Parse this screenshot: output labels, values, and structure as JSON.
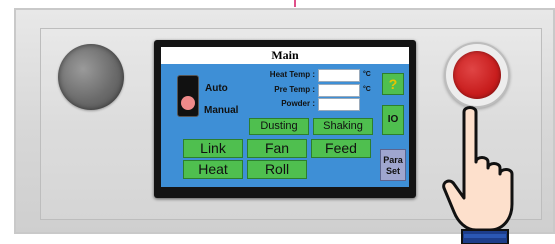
{
  "screen": {
    "title": "Main",
    "mode": {
      "auto_label": "Auto",
      "manual_label": "Manual"
    },
    "fields": [
      {
        "label": "Heat Temp :",
        "value": "",
        "unit": "°C"
      },
      {
        "label": "Pre Temp :",
        "value": "",
        "unit": "°C"
      },
      {
        "label": "Powder :",
        "value": "",
        "unit": ""
      }
    ],
    "buttons": {
      "dusting": "Dusting",
      "shaking": "Shaking",
      "link": "Link",
      "fan": "Fan",
      "feed": "Feed",
      "heat": "Heat",
      "roll": "Roll"
    },
    "side_buttons": {
      "help": "?",
      "io": "IO",
      "para_set_line1": "Para",
      "para_set_line2": "Set"
    }
  },
  "colors": {
    "screen_bg": "#3e8fd6",
    "button_green": "#4fbf4f",
    "help_yellow": "#e8c400",
    "emergency_red": "#c81d1d"
  },
  "icons": {
    "mode_switch": "toggle-switch-icon",
    "emergency": "emergency-stop-icon",
    "hand": "pointing-hand-icon"
  }
}
